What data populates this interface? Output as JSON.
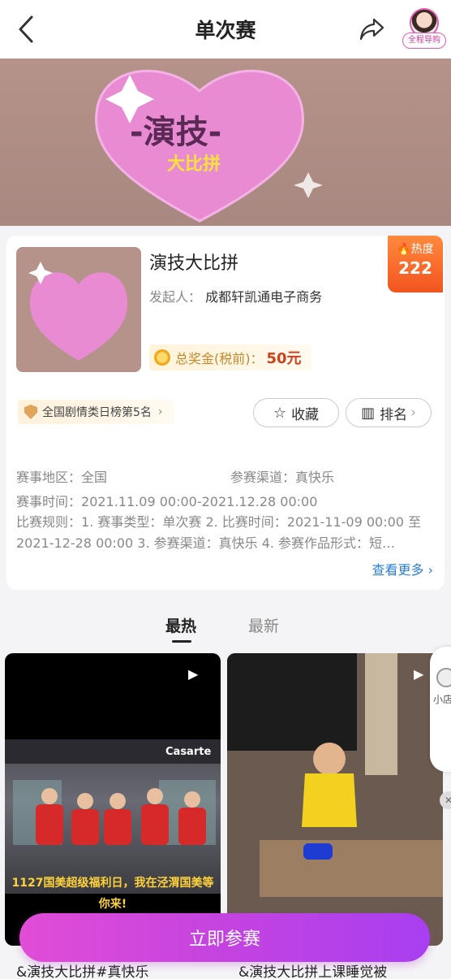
{
  "header": {
    "title": "单次赛",
    "guide_label": "全程导购"
  },
  "event": {
    "name": "演技大比拼",
    "sponsor_label": "发起人：",
    "sponsor": "成都轩凯通电子商务",
    "prize_label": "总奖金(税前)：",
    "prize_amount": "50元",
    "heat_label": "热度",
    "heat_value": "222",
    "rank_text": "全国剧情类日榜第5名",
    "favorite_label": "收藏",
    "ranking_label": "排名",
    "region_label": "赛事地区：",
    "region_value": "全国",
    "channel_label": "参赛渠道：",
    "channel_value": "真快乐",
    "time_label": "赛事时间：",
    "time_value": "2021.11.09 00:00-2021.12.28 00:00",
    "rules_label": "比赛规则：",
    "rules_value": "1. 赛事类型：单次赛 2. 比赛时间：2021-11-09 00:00 至 2021-12-28 00:00 3. 参赛渠道：真快乐 4. 参赛作品形式：短…",
    "see_more": "查看更多"
  },
  "tabs": [
    {
      "label": "最热",
      "active": true
    },
    {
      "label": "最新",
      "active": false
    }
  ],
  "videos": [
    {
      "title": "&演技大比拼#真快乐",
      "caption": "1127国美超级福利日，我在泾渭国美等你来!",
      "store_sign": "Casarte"
    },
    {
      "title": "&演技大比拼上课睡觉被"
    }
  ],
  "floating": {
    "label": "小店"
  },
  "cta_label": "立即参赛",
  "banner": {
    "title": "-演技-",
    "subtitle": "大比拼"
  },
  "colors": {
    "accent": "#d43b9b",
    "heat": "#f2541f",
    "link": "#2c7fd6"
  }
}
